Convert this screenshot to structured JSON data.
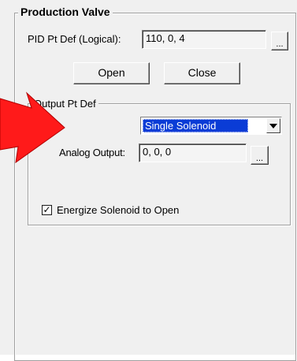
{
  "production_valve": {
    "title": "Production Valve",
    "pid_label": "PID Pt Def (Logical):",
    "pid_value": "110, 0, 4",
    "browse_label": "...",
    "open_label": "Open",
    "close_label": "Close"
  },
  "output_pt_def": {
    "title": "Output Pt Def",
    "solenoid_type": "Single Solenoid",
    "analog_output_label": "Analog Output:",
    "analog_output_value": "0, 0, 0",
    "browse_label": "...",
    "energize_label": "Energize Solenoid to Open",
    "energize_checked": true,
    "energize_mark": "✓"
  },
  "annotation": {
    "arrow_color": "#ff1a1a"
  }
}
